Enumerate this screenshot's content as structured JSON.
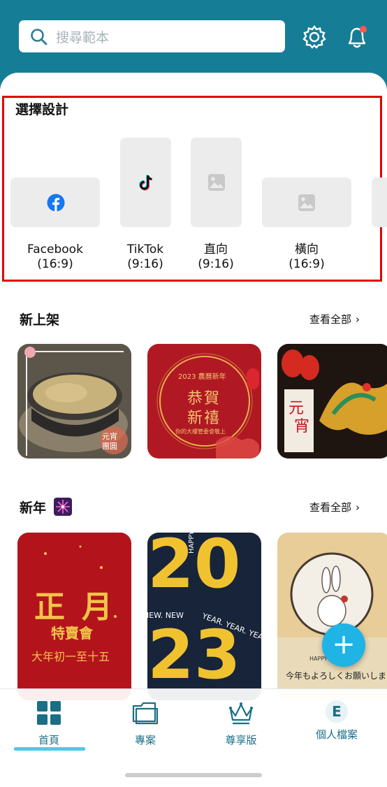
{
  "search": {
    "placeholder": "搜尋範本"
  },
  "design_section": {
    "title": "選擇設計",
    "options": [
      {
        "name": "Facebook",
        "ratio": "(16:9)",
        "icon": "facebook-icon"
      },
      {
        "name": "TikTok",
        "ratio": "(9:16)",
        "icon": "tiktok-icon"
      },
      {
        "name": "直向",
        "ratio": "(9:16)",
        "icon": "image-icon"
      },
      {
        "name": "橫向",
        "ratio": "(16:9)",
        "icon": "image-icon"
      }
    ]
  },
  "new_section": {
    "title": "新上架",
    "see_all": "查看全部",
    "thumbs": [
      {
        "texts": [
          "元宵",
          "團圓"
        ]
      },
      {
        "texts": [
          "2023 農曆新年",
          "恭賀",
          "新禧",
          "你的大樓管委會敬上"
        ]
      },
      {
        "texts": [
          "元",
          "宵"
        ]
      }
    ]
  },
  "newyear_section": {
    "title": "新年",
    "see_all": "查看全部",
    "thumbs": [
      {
        "texts": [
          "正",
          "月",
          "特賣會",
          "大年初一至十五"
        ]
      },
      {
        "texts": [
          "20",
          "23",
          "HAPPY. HAPPY. HAPP",
          "NEW. NEW",
          "YEAR. YEAR. YEA"
        ]
      },
      {
        "texts": [
          "今年もよろしくお願いします",
          "HAPPY"
        ]
      }
    ]
  },
  "tabs": [
    {
      "label": "首頁",
      "icon": "grid-icon"
    },
    {
      "label": "專案",
      "icon": "folder-icon"
    },
    {
      "label": "尊享版",
      "icon": "crown-icon"
    },
    {
      "label": "個人檔案",
      "icon": "avatar",
      "avatar_letter": "E"
    }
  ],
  "colors": {
    "header": "#167d96",
    "accent": "#4fc9e4",
    "fab": "#1fb3e6",
    "highlight": "#e30000",
    "tab_text": "#1a6f86"
  }
}
